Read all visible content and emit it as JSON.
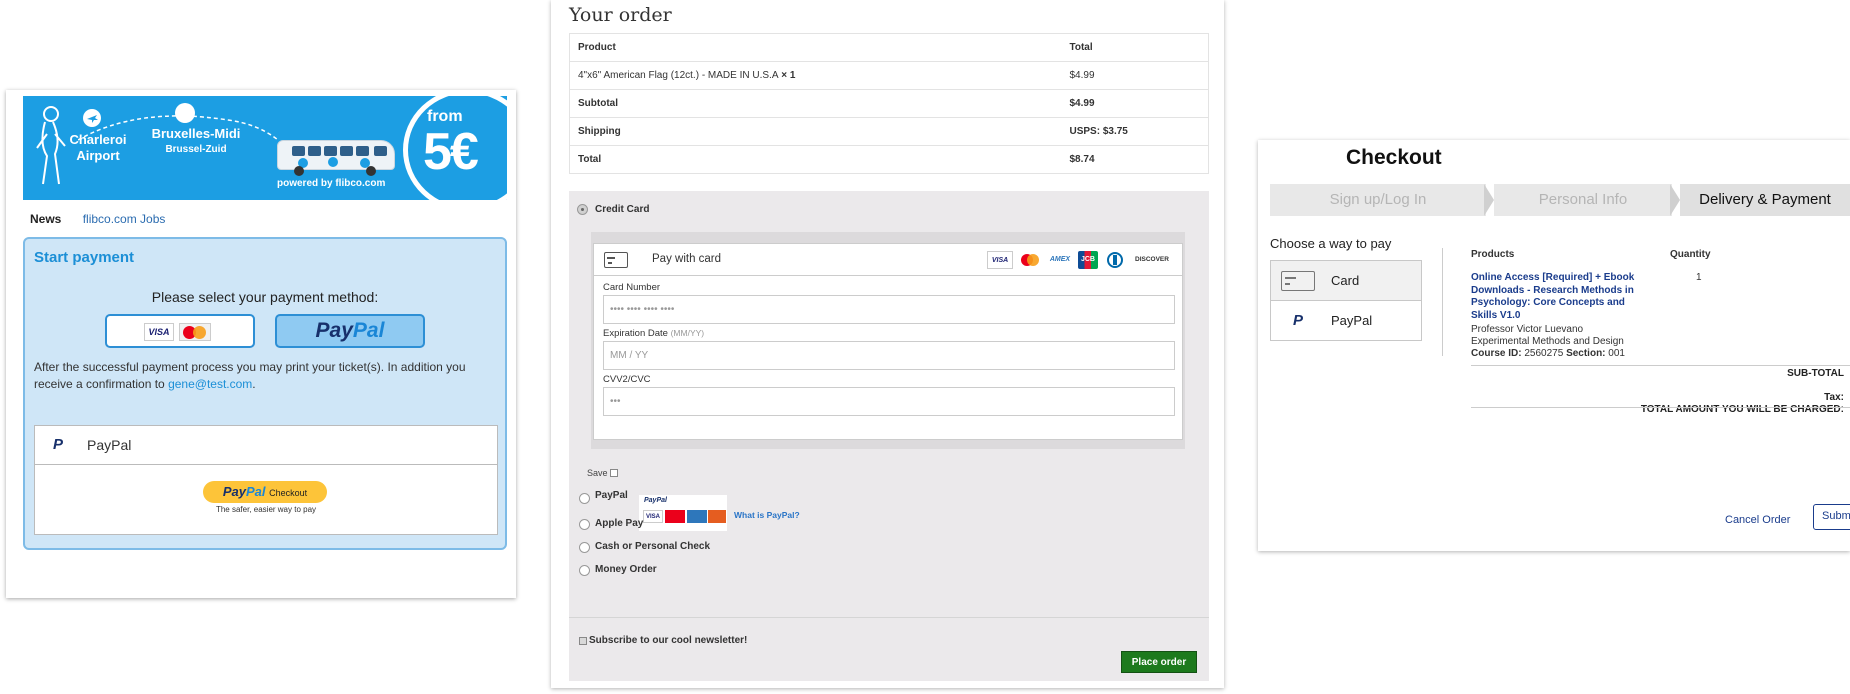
{
  "flibco": {
    "banner": {
      "origin": "Charleroi Airport",
      "destination": "Bruxelles-Midi",
      "destination_sub": "Brussel-Zuid",
      "from": "from",
      "price": "5€",
      "powered_by": "powered by flibco.com"
    },
    "nav": {
      "news": "News",
      "jobs": "flibco.com Jobs"
    },
    "title": "Start payment",
    "select_prompt": "Please select your payment method:",
    "method_paypal_pay": "Pay",
    "method_paypal_pal": "Pal",
    "visa_label": "VISA",
    "after_text": "After the successful payment process you may print your ticket(s). In addition you receive a confirmation to ",
    "email": "gene@test.com",
    "after_end": ".",
    "paypal_option": "PayPal",
    "paypal_btn_pay": "Pay",
    "paypal_btn_pal": "Pal",
    "paypal_btn_checkout": "Checkout",
    "paypal_tagline": "The safer, easier way to pay",
    "colors": {
      "banner": "#1c9ee3",
      "box": "#cfe6f7",
      "accent": "#1c8fd6"
    }
  },
  "order": {
    "heading": "Your order",
    "table": {
      "headers": [
        "Product",
        "Total"
      ],
      "rows": [
        {
          "label": "4\"x6\" American Flag (12ct.) - MADE IN U.S.A",
          "qty": " × 1",
          "value": "$4.99"
        },
        {
          "label": "Subtotal",
          "value": "$4.99"
        },
        {
          "label": "Shipping",
          "value": "USPS: $3.75"
        },
        {
          "label": "Total",
          "value": "$8.74"
        }
      ]
    },
    "methods": {
      "credit_card": "Credit Card",
      "paypal": "PayPal",
      "apple_pay": "Apple Pay",
      "cash": "Cash or Personal Check",
      "money_order": "Money Order"
    },
    "card_form": {
      "header": "Pay with card",
      "brands": [
        "VISA",
        "MC",
        "AMEX",
        "JCB",
        "DINERS",
        "DISCOVER"
      ],
      "card_number_label": "Card Number",
      "card_number_placeholder": "•••• •••• •••• ••••",
      "expiry_label": "Expiration Date",
      "expiry_hint": "(MM/YY)",
      "expiry_placeholder": "MM / YY",
      "cvv_label": "CVV2/CVC",
      "cvv_placeholder": "•••",
      "save_label": "Save"
    },
    "paypal_logo_text": "PayPal",
    "what_is_paypal": "What is PayPal?",
    "newsletter": "Subscribe to our cool newsletter!",
    "place_order": "Place order",
    "colors": {
      "pay_bg": "#ebe9eb",
      "place_btn": "#1d7a1d"
    }
  },
  "checkout": {
    "title": "Checkout",
    "steps": [
      "Sign up/Log In",
      "Personal Info",
      "Delivery & Payment"
    ],
    "active_step": 2,
    "choose_label": "Choose a way to pay",
    "options": [
      "Card",
      "PayPal"
    ],
    "paypal_glyph": "P",
    "columns": {
      "products": "Products",
      "quantity": "Quantity"
    },
    "course": {
      "title": "Online Access [Required] + Ebook Downloads - Research Methods in Psychology: Core Concepts and Skills V1.0",
      "professor": "Professor Victor Luevano",
      "section_name": "Experimental Methods and Design",
      "course_id_label": "Course ID:",
      "course_id": "2560275",
      "section_label": "Section:",
      "section": "001",
      "quantity": "1"
    },
    "subtotal_label": "SUB-TOTAL",
    "tax_label": "Tax:",
    "total_label": "TOTAL AMOUNT YOU WILL BE CHARGED:",
    "cancel": "Cancel Order",
    "submit": "Subm"
  }
}
